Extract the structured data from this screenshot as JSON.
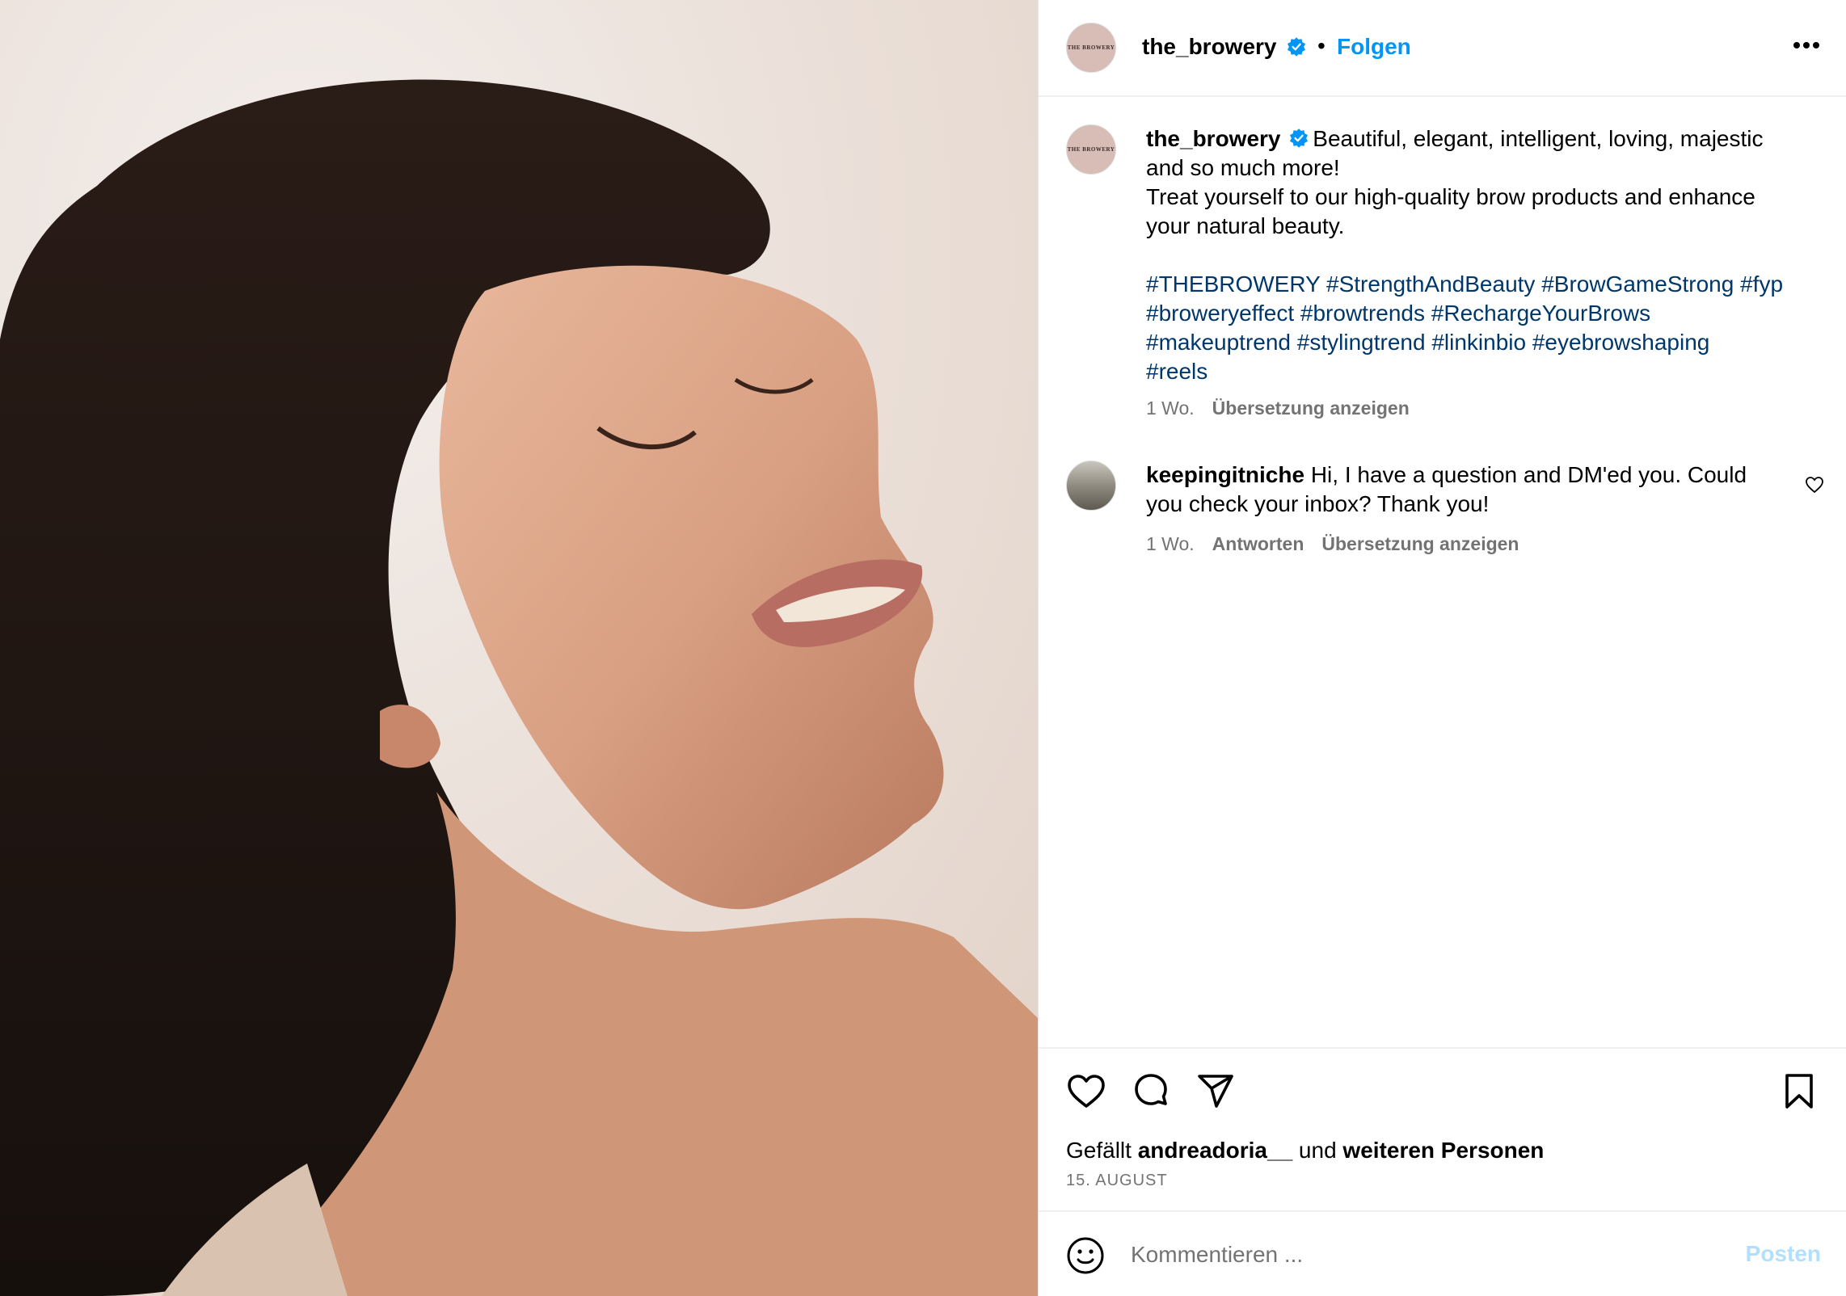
{
  "post": {
    "account": "the_browery",
    "avatar_logo_text": "THE BROWERY",
    "follow_label": "Folgen",
    "separator": "•"
  },
  "caption": {
    "username": "the_browery",
    "line1": "Beautiful, elegant, intelligent, loving, majestic",
    "line2": "and so much more!",
    "line3": "Treat yourself to our high-quality brow products and enhance",
    "line4": "your natural beauty.",
    "hashtags1": "#THEBROWERY #StrengthAndBeauty #BrowGameStrong #fyp",
    "hashtags2": "#broweryeffect #browtrends #RechargeYourBrows",
    "hashtags3": "#makeuptrend #stylingtrend #linkinbio #eyebrowshaping",
    "hashtags4": "#reels",
    "time": "1 Wo.",
    "translate": "Übersetzung anzeigen"
  },
  "comment": {
    "username": "keepingitniche",
    "line1": "Hi, I have a question and DM'ed you. Could",
    "line2": "you check your inbox? Thank you!",
    "time": "1 Wo.",
    "reply": "Antworten",
    "translate": "Übersetzung anzeigen"
  },
  "likes": {
    "prefix": "Gefällt",
    "user": "andreadoria__",
    "middle": "und",
    "others": "weiteren Personen"
  },
  "date": "15. AUGUST",
  "comment_box": {
    "placeholder": "Kommentieren ...",
    "post_label": "Posten"
  },
  "icons": {
    "verified": "verified-badge-icon",
    "more": "more-options-icon",
    "like": "heart-icon",
    "comment": "comment-icon",
    "share": "share-icon",
    "save": "bookmark-icon",
    "emoji": "emoji-icon"
  },
  "colors": {
    "link_blue": "#0095f6",
    "hashtag_blue": "#00376b",
    "muted": "#737373",
    "post_disabled": "#b2dffc"
  }
}
